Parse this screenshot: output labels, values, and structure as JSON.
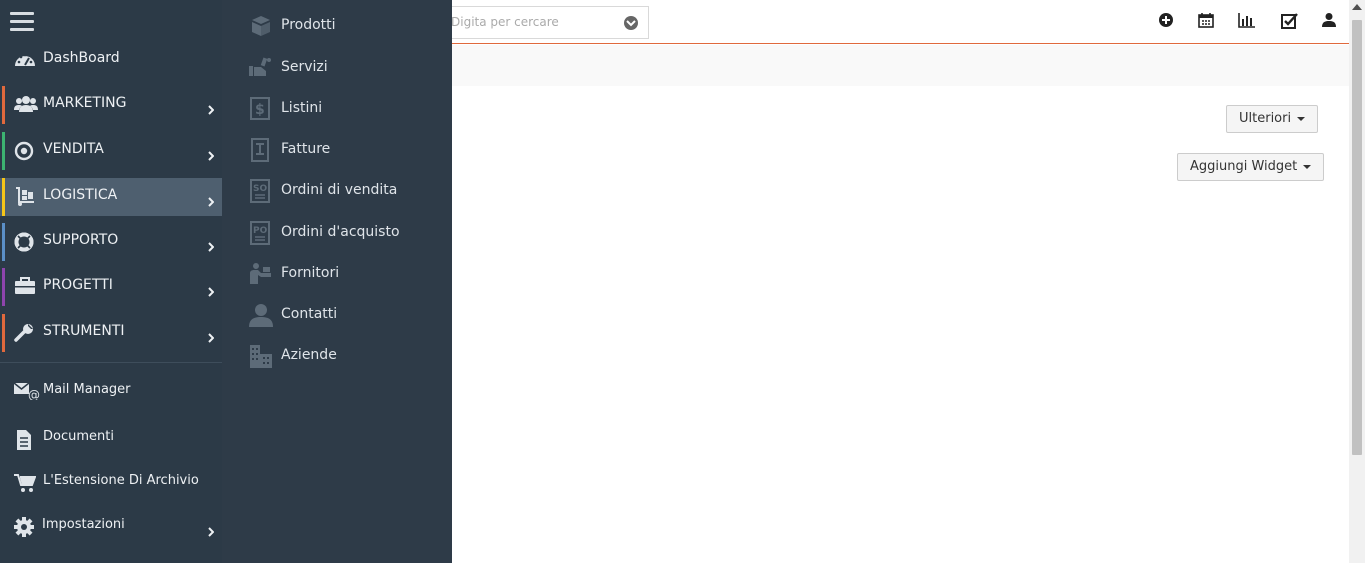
{
  "search": {
    "placeholder": "Digita per cercare"
  },
  "header_icons": [
    "plus-circle-icon",
    "calendar-icon",
    "bar-chart-icon",
    "check-square-icon",
    "user-icon"
  ],
  "toolbar": {
    "more_label": "Ulteriori",
    "add_widget_label": "Aggiungi Widget"
  },
  "sidebar": {
    "items": [
      {
        "label": "DashBoard",
        "icon": "dashboard-icon",
        "accent": "",
        "arrow": false
      },
      {
        "label": "MARKETING",
        "icon": "users-icon",
        "accent": "#e0693d",
        "arrow": true
      },
      {
        "label": "VENDITA",
        "icon": "target-icon",
        "accent": "#3cb371",
        "arrow": true
      },
      {
        "label": "LOGISTICA",
        "icon": "dolly-icon",
        "accent": "#f5c518",
        "arrow": true,
        "active": true
      },
      {
        "label": "SUPPORTO",
        "icon": "life-ring-icon",
        "accent": "#5b8fc7",
        "arrow": true
      },
      {
        "label": "PROGETTI",
        "icon": "briefcase-icon",
        "accent": "#8e44ad",
        "arrow": true
      },
      {
        "label": "STRUMENTI",
        "icon": "wrench-icon",
        "accent": "#e0693d",
        "arrow": true
      }
    ],
    "lower_items": [
      {
        "label": "Mail Manager",
        "icon": "mail-at-icon",
        "arrow": false
      },
      {
        "label": "Documenti",
        "icon": "document-icon",
        "arrow": false
      },
      {
        "label": "L'Estensione Di Archivio",
        "icon": "cart-icon",
        "arrow": false
      },
      {
        "label": "Impostazioni",
        "icon": "gear-icon",
        "arrow": true
      }
    ]
  },
  "flyout": {
    "items": [
      {
        "label": "Prodotti",
        "icon": "box-icon"
      },
      {
        "label": "Servizi",
        "icon": "service-hand-icon"
      },
      {
        "label": "Listini",
        "icon": "price-list-icon"
      },
      {
        "label": "Fatture",
        "icon": "invoice-icon"
      },
      {
        "label": "Ordini di vendita",
        "icon": "sales-order-icon",
        "badge": "SO"
      },
      {
        "label": "Ordini d'acquisto",
        "icon": "purchase-order-icon",
        "badge": "PO"
      },
      {
        "label": "Fornitori",
        "icon": "vendor-icon"
      },
      {
        "label": "Contatti",
        "icon": "contact-icon"
      },
      {
        "label": "Aziende",
        "icon": "building-icon"
      }
    ]
  },
  "colors": {
    "sidebar_bg": "#2c3a47",
    "flyout_bg": "#2e3b48",
    "header_border": "#e0693d",
    "active_item_bg": "#4e5f6f"
  }
}
